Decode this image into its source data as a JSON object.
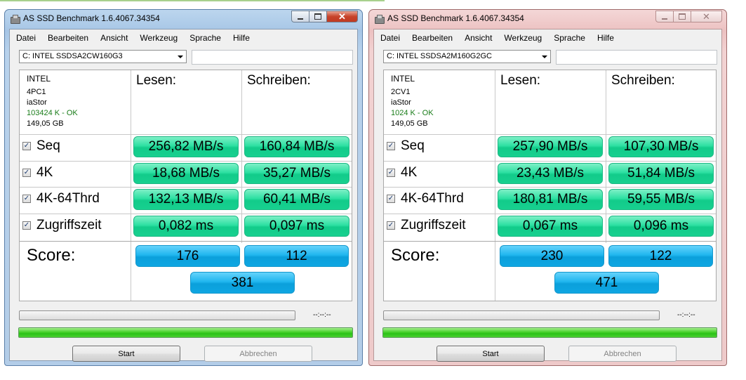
{
  "windows": [
    {
      "title": "AS SSD Benchmark 1.6.4067.34354",
      "menu": [
        "Datei",
        "Bearbeiten",
        "Ansicht",
        "Werkzeug",
        "Sprache",
        "Hilfe"
      ],
      "drive": "C: INTEL SSDSA2CW160G3",
      "info": {
        "vendor": "INTEL",
        "firmware": "4PC1",
        "driver": "iaStor",
        "status": "103424 K - OK",
        "size": "149,05 GB"
      },
      "headers": {
        "read": "Lesen:",
        "write": "Schreiben:"
      },
      "rows": [
        {
          "label": "Seq",
          "read": "256,82 MB/s",
          "write": "160,84 MB/s"
        },
        {
          "label": "4K",
          "read": "18,68 MB/s",
          "write": "35,27 MB/s"
        },
        {
          "label": "4K-64Thrd",
          "read": "132,13 MB/s",
          "write": "60,41 MB/s"
        },
        {
          "label": "Zugriffszeit",
          "read": "0,082 ms",
          "write": "0,097 ms"
        }
      ],
      "score": {
        "label": "Score:",
        "read": "176",
        "write": "112",
        "total": "381"
      },
      "timer": "--:--:--",
      "buttons": {
        "start": "Start",
        "cancel": "Abbrechen"
      }
    },
    {
      "title": "AS SSD Benchmark 1.6.4067.34354",
      "menu": [
        "Datei",
        "Bearbeiten",
        "Ansicht",
        "Werkzeug",
        "Sprache",
        "Hilfe"
      ],
      "drive": "C: INTEL SSDSA2M160G2GC",
      "info": {
        "vendor": "INTEL",
        "firmware": "2CV1",
        "driver": "iaStor",
        "status": "1024 K - OK",
        "size": "149,05 GB"
      },
      "headers": {
        "read": "Lesen:",
        "write": "Schreiben:"
      },
      "rows": [
        {
          "label": "Seq",
          "read": "257,90 MB/s",
          "write": "107,30 MB/s"
        },
        {
          "label": "4K",
          "read": "23,43 MB/s",
          "write": "51,84 MB/s"
        },
        {
          "label": "4K-64Thrd",
          "read": "180,81 MB/s",
          "write": "59,55 MB/s"
        },
        {
          "label": "Zugriffszeit",
          "read": "0,067 ms",
          "write": "0,096 ms"
        }
      ],
      "score": {
        "label": "Score:",
        "read": "230",
        "write": "122",
        "total": "471"
      },
      "timer": "--:--:--",
      "buttons": {
        "start": "Start",
        "cancel": "Abbrechen"
      }
    }
  ],
  "colors": {
    "result_pill": "#17d08f",
    "score_pill": "#0ea6e2",
    "status_ok": "#1a7d1a",
    "progress_done": "#2bc217"
  },
  "icons": {
    "app": "drive-icon",
    "checkbox": "check-icon"
  }
}
